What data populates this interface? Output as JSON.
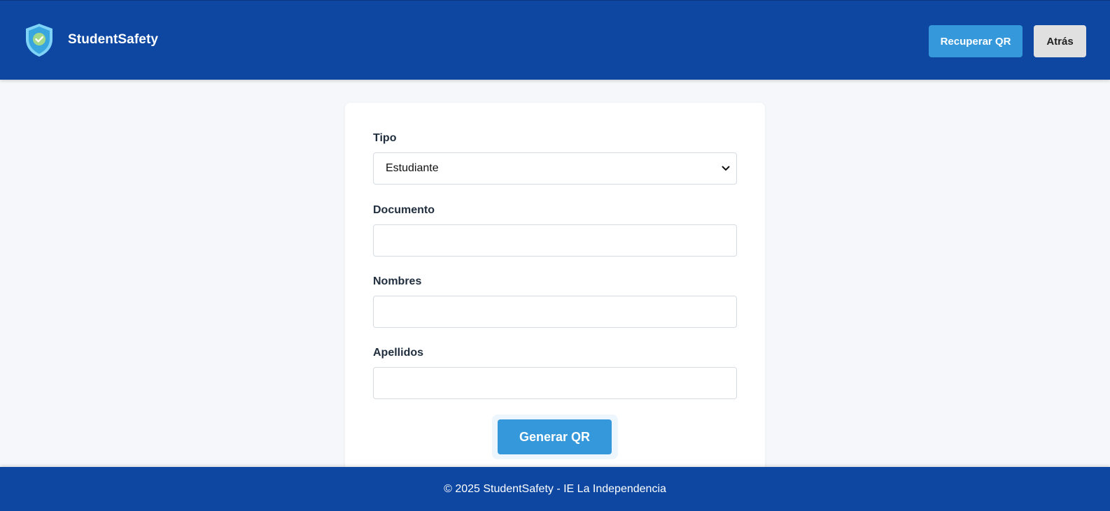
{
  "header": {
    "brand_name": "StudentSafety",
    "logo_icon": "shield-check-icon",
    "recover_button": "Recuperar QR",
    "back_button": "Atrás"
  },
  "form": {
    "fields": [
      {
        "label": "Tipo",
        "type": "select",
        "value": "Estudiante"
      },
      {
        "label": "Documento",
        "type": "text",
        "value": ""
      },
      {
        "label": "Nombres",
        "type": "text",
        "value": ""
      },
      {
        "label": "Apellidos",
        "type": "text",
        "value": ""
      }
    ],
    "submit_button": "Generar QR"
  },
  "footer": {
    "text": "© 2025 StudentSafety - IE La Independencia"
  },
  "colors": {
    "header_bg": "#0d47a1",
    "accent": "#3498db",
    "back_button_bg": "#e0e0e0",
    "page_bg": "#f5f7fa"
  }
}
